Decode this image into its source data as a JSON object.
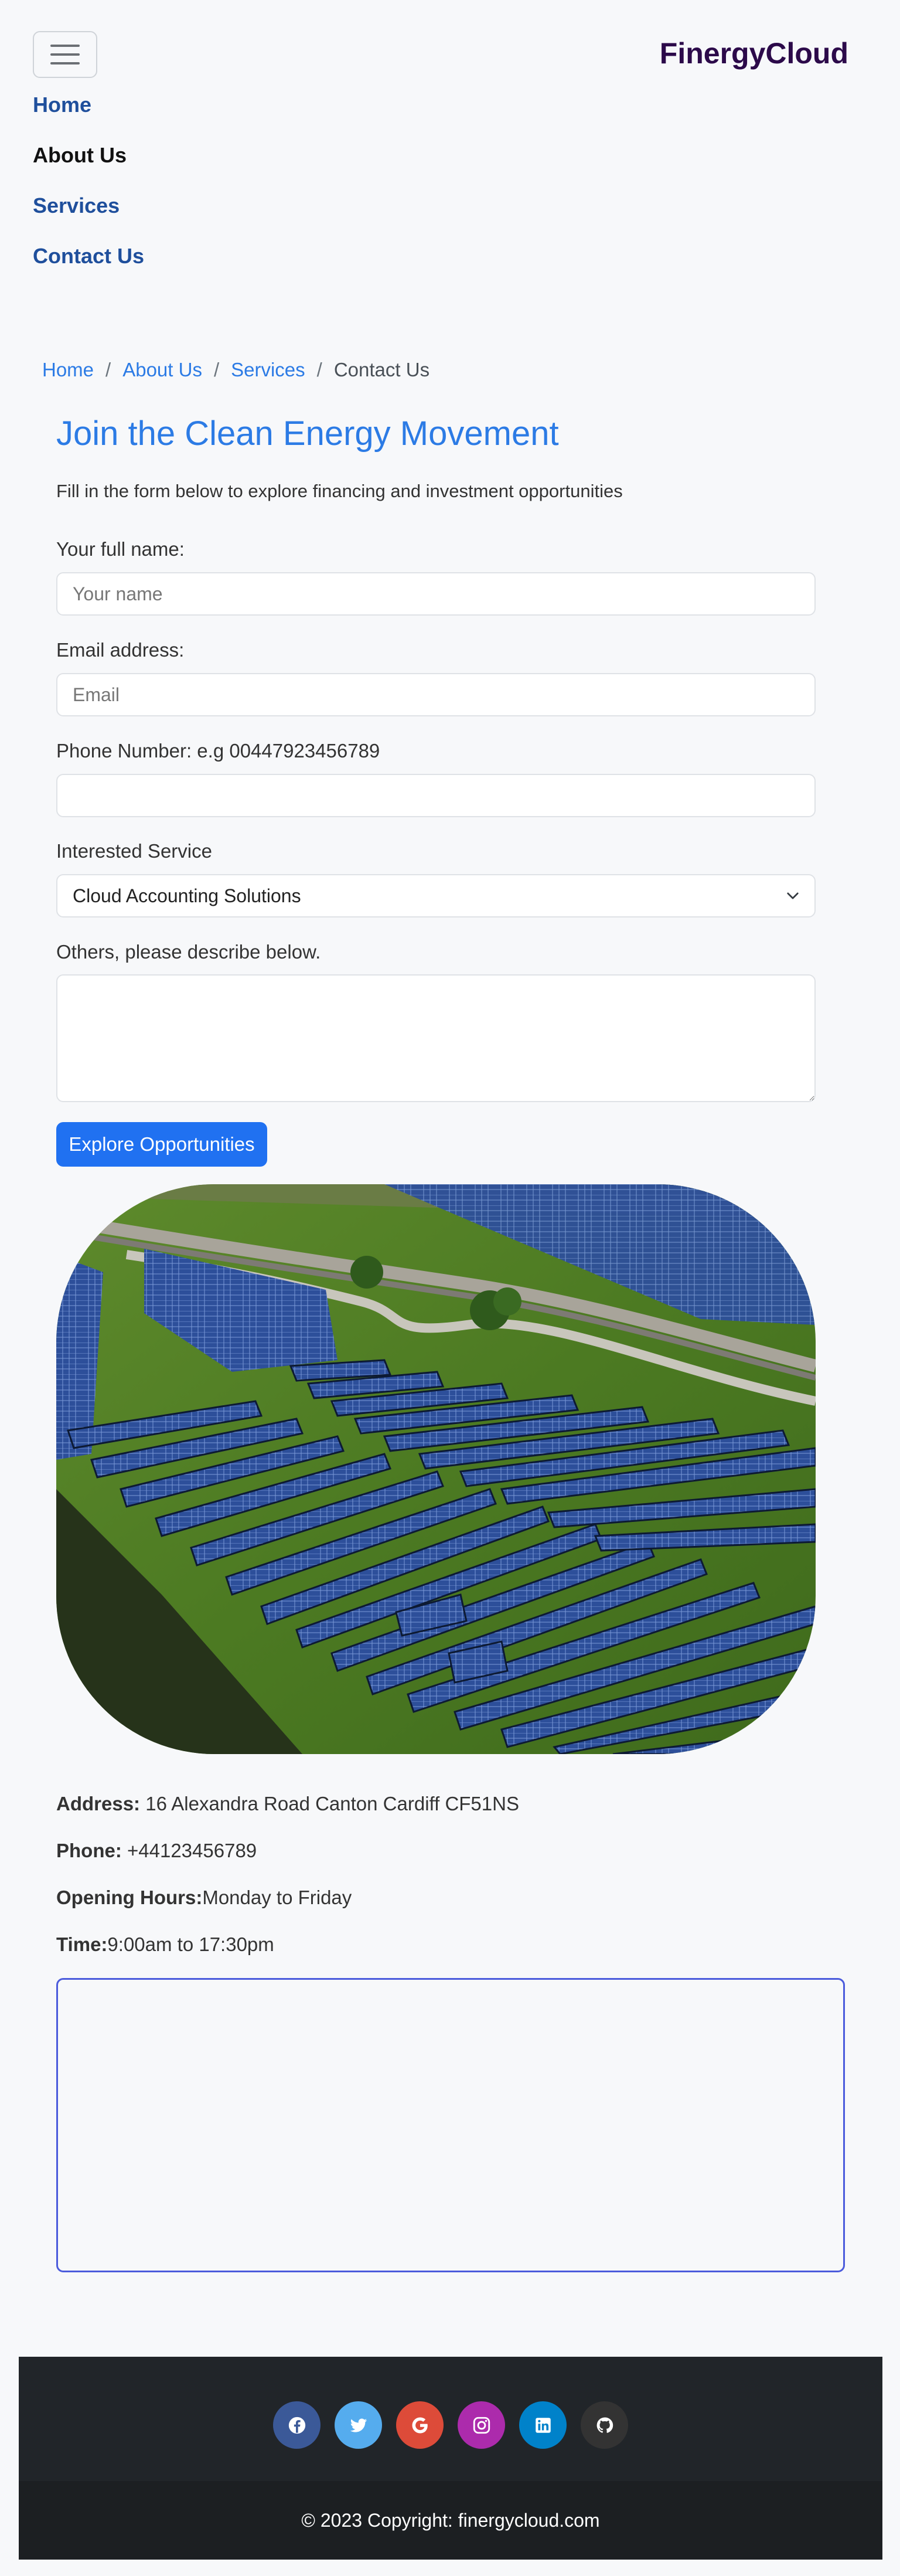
{
  "brand": "FinergyCloud",
  "nav": {
    "items": [
      {
        "label": "Home",
        "active": false
      },
      {
        "label": "About Us",
        "active": true
      },
      {
        "label": "Services",
        "active": false
      },
      {
        "label": "Contact Us",
        "active": false
      }
    ]
  },
  "breadcrumb": {
    "items": [
      "Home",
      "About Us",
      "Services"
    ],
    "separator": "/",
    "current": "Contact Us"
  },
  "form": {
    "title": "Join the Clean Energy Movement",
    "lead": "Fill in the form below to explore financing and investment opportunities",
    "name_label": "Your full name:",
    "name_placeholder": "Your name",
    "email_label": "Email address:",
    "email_placeholder": "Email",
    "phone_label": "Phone Number: e.g 00447923456789",
    "phone_value": "",
    "service_label": "Interested Service",
    "service_selected": "Cloud Accounting Solutions",
    "others_label": "Others, please describe below.",
    "others_value": "",
    "submit_label": "Explore Opportunities"
  },
  "contact": {
    "address_label": "Address:",
    "address_value": " 16 Alexandra Road Canton Cardiff CF51NS",
    "phone_label": "Phone:",
    "phone_value": " +44123456789",
    "hours_label": "Opening Hours:",
    "hours_value": "Monday to Friday",
    "time_label": "Time:",
    "time_value": "9:00am to 17:30pm"
  },
  "footer": {
    "socials": [
      {
        "icon": "facebook-icon",
        "color": "#3b5998"
      },
      {
        "icon": "twitter-icon",
        "color": "#55acee"
      },
      {
        "icon": "google-icon",
        "color": "#dd4b39"
      },
      {
        "icon": "instagram-icon",
        "color": "#ac2bac"
      },
      {
        "icon": "linkedin-icon",
        "color": "#0082ca"
      },
      {
        "icon": "github-icon",
        "color": "#333333"
      }
    ],
    "copyright": "© 2023 Copyright: finergycloud.com"
  },
  "colors": {
    "accent": "#2c7be5",
    "button": "#2071f1",
    "brand": "#2c0a4a",
    "footer_bg": "#212529"
  }
}
